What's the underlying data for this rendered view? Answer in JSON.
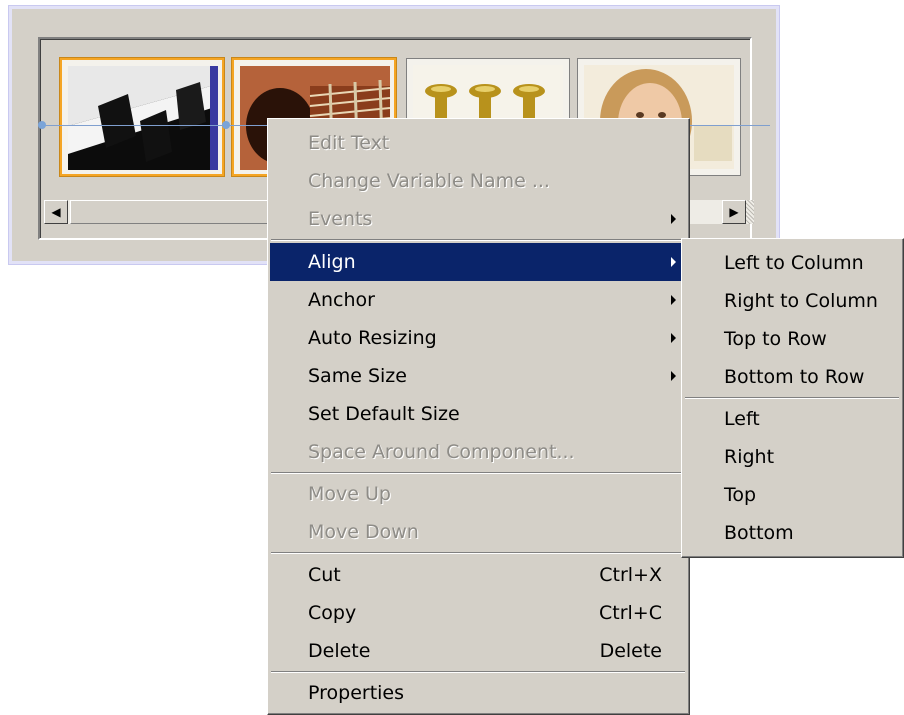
{
  "context_menu": {
    "items": [
      {
        "label": "Edit Text",
        "disabled": true
      },
      {
        "label": "Change Variable Name ...",
        "disabled": true
      },
      {
        "label": "Events",
        "disabled": true,
        "submenu": true
      },
      {
        "label": "Align",
        "active": true,
        "submenu": true
      },
      {
        "label": "Anchor",
        "submenu": true
      },
      {
        "label": "Auto Resizing",
        "submenu": true
      },
      {
        "label": "Same Size",
        "submenu": true
      },
      {
        "label": "Set Default Size"
      },
      {
        "label": "Space Around Component...",
        "disabled": true
      },
      {
        "label": "Move Up",
        "disabled": true
      },
      {
        "label": "Move Down",
        "disabled": true
      },
      {
        "label": "Cut",
        "shortcut": "Ctrl+X"
      },
      {
        "label": "Copy",
        "shortcut": "Ctrl+C"
      },
      {
        "label": "Delete",
        "shortcut": "Delete"
      },
      {
        "label": "Properties"
      }
    ]
  },
  "align_submenu": {
    "items": [
      {
        "label": "Left to Column"
      },
      {
        "label": "Right to Column"
      },
      {
        "label": "Top to Row"
      },
      {
        "label": "Bottom to Row"
      },
      {
        "label": "Left"
      },
      {
        "label": "Right"
      },
      {
        "label": "Top"
      },
      {
        "label": "Bottom"
      }
    ]
  },
  "scrollbar": {
    "left_arrow": "◀",
    "right_arrow": "▶"
  },
  "colors": {
    "highlight": "#0a246a",
    "menu_bg": "#d4d0c8",
    "selection_border": "#f5a524"
  }
}
